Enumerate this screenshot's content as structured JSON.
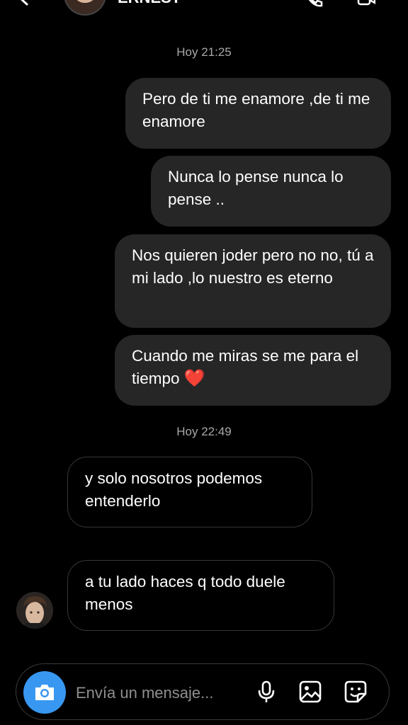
{
  "header": {
    "contact_name": "ERNEST",
    "icons": [
      "back-arrow-icon",
      "phone-icon",
      "video-icon"
    ]
  },
  "conversation": {
    "groups": [
      {
        "timestamp": "Hoy 21:25",
        "messages": [
          {
            "direction": "outgoing",
            "text": "Pero de ti me enamore ,de ti me enamore"
          },
          {
            "direction": "outgoing",
            "text": "Nunca lo pense nunca lo pense .."
          },
          {
            "direction": "outgoing",
            "text": "Nos quieren joder pero no no, tú a mi lado ,lo nuestro es eterno"
          },
          {
            "direction": "outgoing",
            "text": "Cuando me miras se me para el tiempo",
            "emoji": "❤️"
          }
        ]
      },
      {
        "timestamp": "Hoy 22:49",
        "messages": [
          {
            "direction": "incoming",
            "text": "y solo nosotros podemos entenderlo"
          },
          {
            "direction": "incoming",
            "text": "a tu lado haces q todo duele menos"
          }
        ]
      }
    ]
  },
  "composer": {
    "placeholder": "Envía un mensaje...",
    "icons": [
      "camera-icon",
      "microphone-icon",
      "gallery-icon",
      "sticker-icon"
    ]
  },
  "colors": {
    "background": "#000000",
    "outgoing_bubble": "#262626",
    "incoming_border": "#363636",
    "timestamp": "#a8a8a8",
    "camera_button": "#3897f0",
    "heart": "#e0252c"
  }
}
